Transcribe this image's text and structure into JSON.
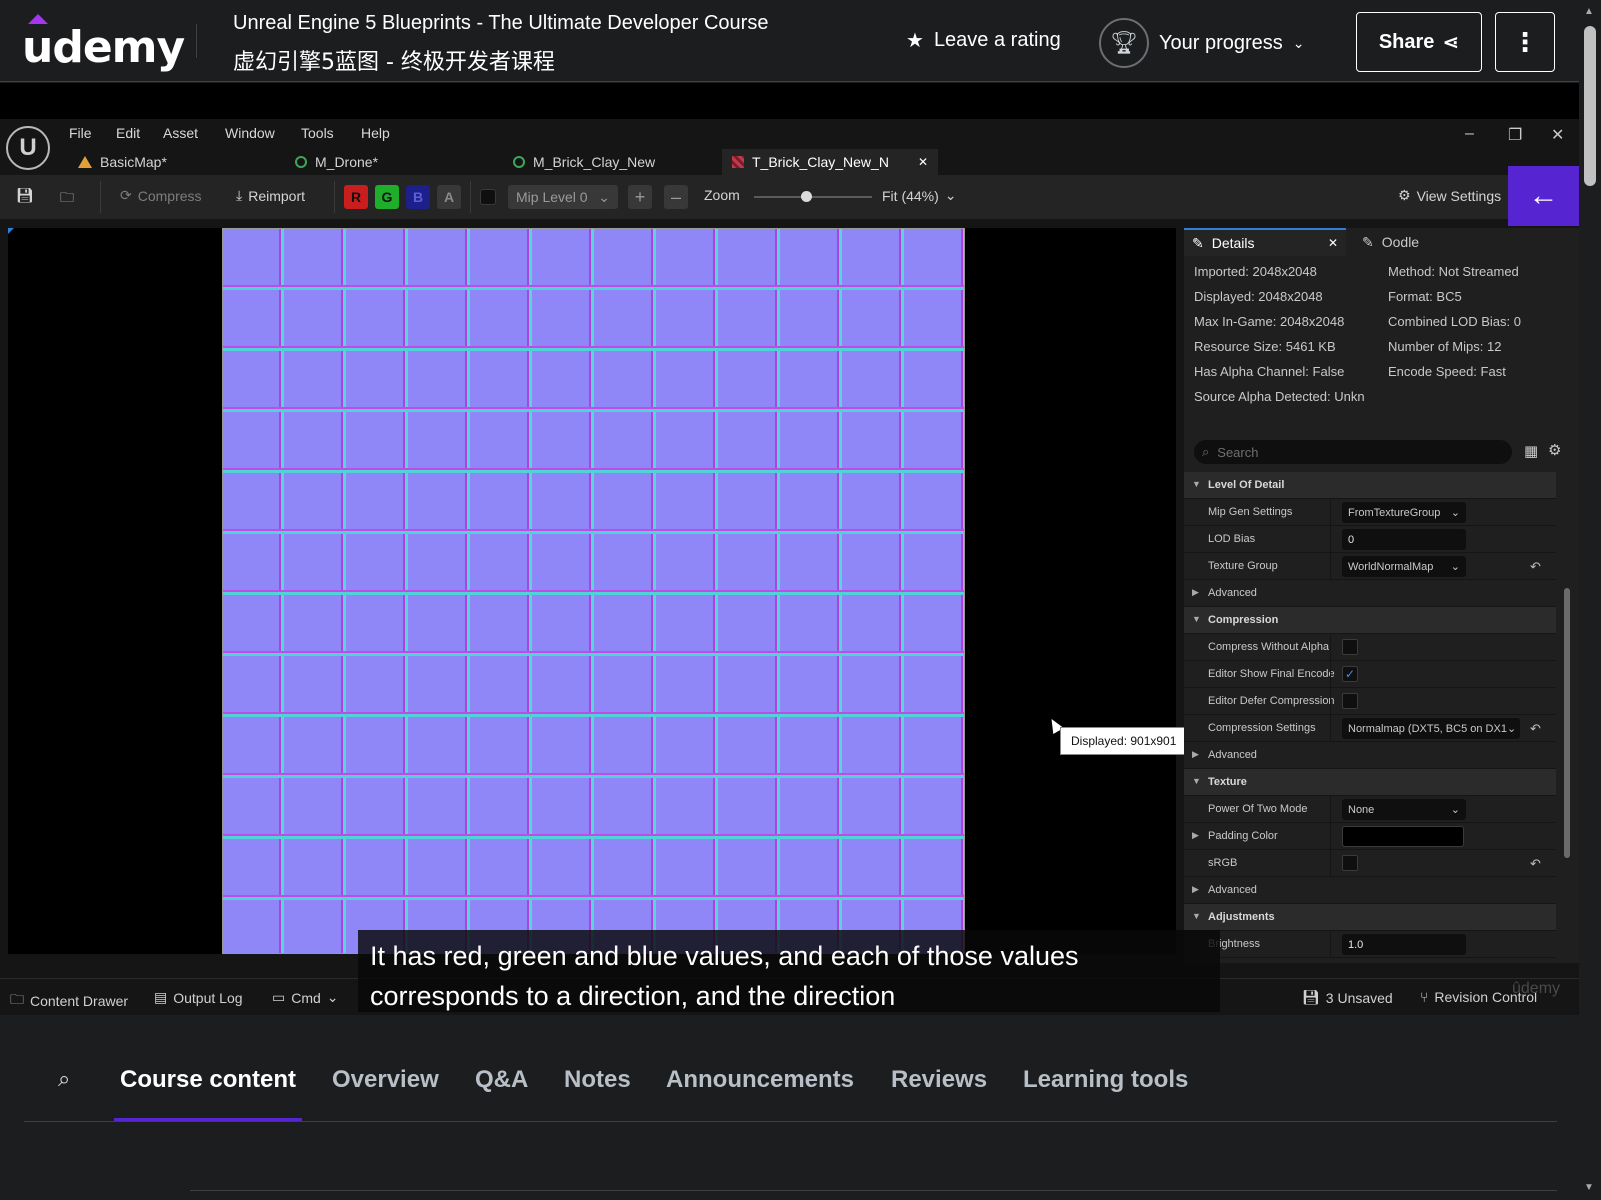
{
  "header": {
    "logo_text": "udemy",
    "course_title_en": "Unreal Engine 5 Blueprints - The Ultimate Developer Course",
    "course_title_zh": "虚幻引擎5蓝图 - 终极开发者课程",
    "rating_label": "Leave a rating",
    "progress_label": "Your progress",
    "share_label": "Share",
    "more_icon": "vertical-ellipsis-icon"
  },
  "editor": {
    "menu": [
      "File",
      "Edit",
      "Asset",
      "Window",
      "Tools",
      "Help"
    ],
    "tabs": [
      {
        "label": "BasicMap*"
      },
      {
        "label": "M_Drone*"
      },
      {
        "label": "M_Brick_Clay_New"
      },
      {
        "label": "T_Brick_Clay_New_N"
      }
    ],
    "toolbar": {
      "compress": "Compress",
      "reimport": "Reimport",
      "channels": [
        "R",
        "G",
        "B",
        "A"
      ],
      "mip_level": "Mip Level 0",
      "zoom_label": "Zoom",
      "fit": "Fit (44%)",
      "view_settings": "View Settings"
    },
    "tooltip": "Displayed: 901x901",
    "details": {
      "tab_label": "Details",
      "oodle_label": "Oodle",
      "info_left": [
        "Imported: 2048x2048",
        "Displayed: 2048x2048",
        "Max In-Game: 2048x2048",
        "Resource Size: 5461 KB",
        "Has Alpha Channel: False",
        "Source Alpha Detected: Unkn"
      ],
      "info_right": [
        "Method: Not Streamed",
        "Format: BC5",
        "Combined LOD Bias: 0",
        "Number of Mips: 12",
        "Encode Speed: Fast"
      ],
      "search_placeholder": "Search",
      "rows": [
        {
          "label": "Level Of Detail"
        },
        {
          "label": "Mip Gen Settings",
          "value": "FromTextureGroup"
        },
        {
          "label": "LOD Bias",
          "value": "0"
        },
        {
          "label": "Texture Group",
          "value": "WorldNormalMap"
        },
        {
          "label": "Advanced"
        },
        {
          "label": "Compression"
        },
        {
          "label": "Compress Without Alpha"
        },
        {
          "label": "Editor Show Final Encode",
          "value": "✓"
        },
        {
          "label": "Editor Defer Compression"
        },
        {
          "label": "Compression Settings",
          "value": "Normalmap (DXT5, BC5 on DX1"
        },
        {
          "label": "Advanced"
        },
        {
          "label": "Texture"
        },
        {
          "label": "Power Of Two Mode",
          "value": "None"
        },
        {
          "label": "Padding Color"
        },
        {
          "label": "sRGB"
        },
        {
          "label": "Advanced"
        },
        {
          "label": "Adjustments"
        },
        {
          "label": "Brightness",
          "value": "1.0"
        }
      ]
    },
    "statusbar": {
      "content_drawer": "Content Drawer",
      "output_log": "Output Log",
      "cmd": "Cmd",
      "unsaved": "3 Unsaved",
      "revision_control": "Revision Control"
    }
  },
  "captions": {
    "line1": "It has red, green and blue values, and each of those values",
    "line2": "corresponds to a direction, and the direction"
  },
  "watermark": "ûdemy",
  "course_tabs": [
    "Course content",
    "Overview",
    "Q&A",
    "Notes",
    "Announcements",
    "Reviews",
    "Learning tools"
  ],
  "colors": {
    "accent": "#5624d0",
    "udemy_purple": "#a435f0",
    "normal_map_base": "#8f86f7"
  }
}
